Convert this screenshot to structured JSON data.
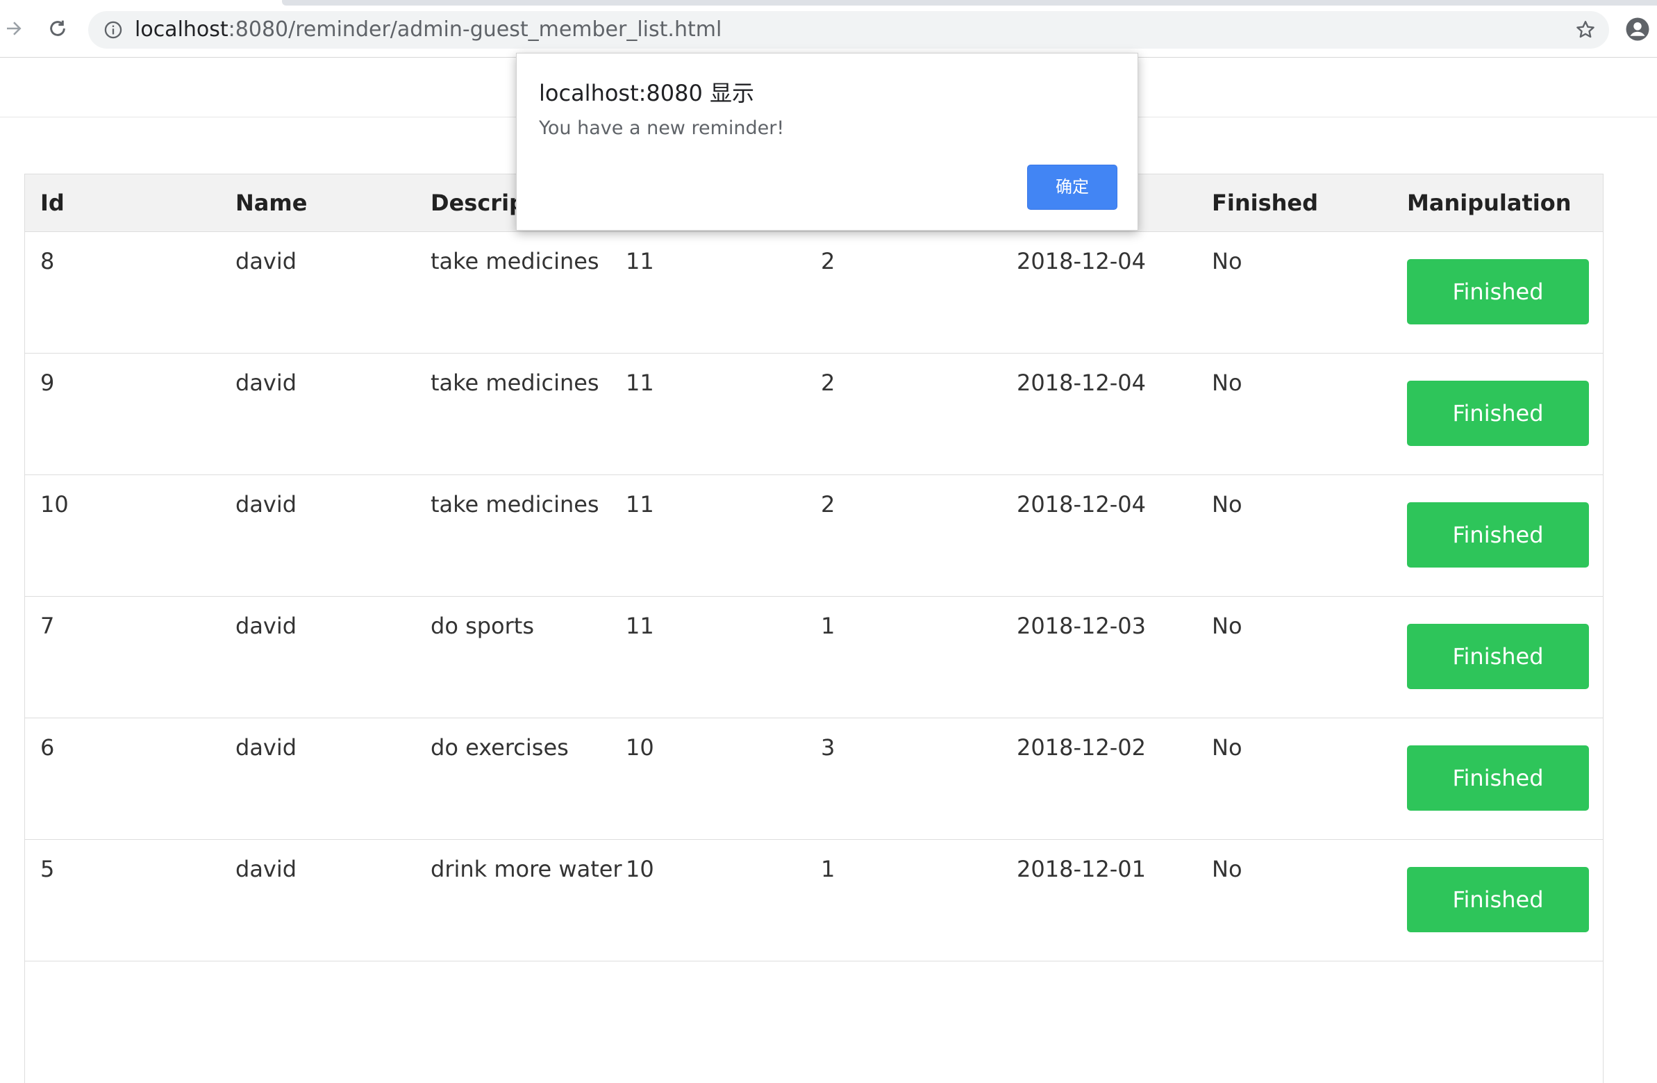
{
  "browser": {
    "url_host": "localhost",
    "url_path": ":8080/reminder/admin-guest_member_list.html",
    "icons": {
      "forward": "forward-arrow-icon",
      "reload": "reload-icon",
      "site_info": "info-icon",
      "bookmark": "star-icon",
      "profile": "profile-avatar-icon"
    }
  },
  "table": {
    "headers": {
      "id": "Id",
      "name": "Name",
      "description": "Descripti",
      "finished": "Finished",
      "manipulation": "Manipulation"
    },
    "rows": [
      {
        "id": "8",
        "name": "david",
        "description": "take medicines",
        "col4": "11",
        "col5": "2",
        "date": "2018-12-04",
        "finished": "No",
        "action": "Finished"
      },
      {
        "id": "9",
        "name": "david",
        "description": "take medicines",
        "col4": "11",
        "col5": "2",
        "date": "2018-12-04",
        "finished": "No",
        "action": "Finished"
      },
      {
        "id": "10",
        "name": "david",
        "description": "take medicines",
        "col4": "11",
        "col5": "2",
        "date": "2018-12-04",
        "finished": "No",
        "action": "Finished"
      },
      {
        "id": "7",
        "name": "david",
        "description": "do sports",
        "col4": "11",
        "col5": "1",
        "date": "2018-12-03",
        "finished": "No",
        "action": "Finished"
      },
      {
        "id": "6",
        "name": "david",
        "description": "do exercises",
        "col4": "10",
        "col5": "3",
        "date": "2018-12-02",
        "finished": "No",
        "action": "Finished"
      },
      {
        "id": "5",
        "name": "david",
        "description": "drink more water",
        "col4": "10",
        "col5": "1",
        "date": "2018-12-01",
        "finished": "No",
        "action": "Finished"
      }
    ]
  },
  "dialog": {
    "title": "localhost:8080 显示",
    "message": "You have a new reminder!",
    "ok_label": "确定"
  },
  "colors": {
    "finish_button": "#2ec55a",
    "dialog_ok": "#4285f4",
    "header_bg": "#f2f2f2"
  }
}
